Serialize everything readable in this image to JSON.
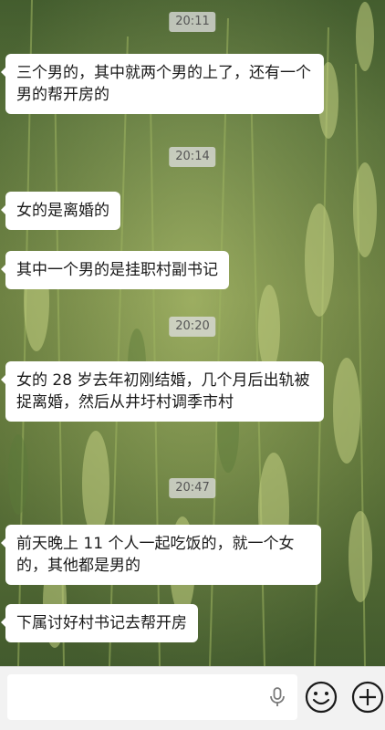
{
  "chat": {
    "messages": [
      {
        "time": "20:11",
        "text": "三个男的，其中就两个男的上了，还有一个男的帮开房的"
      },
      {
        "time": "20:14",
        "text": "女的是离婚的"
      },
      {
        "text": "其中一个男的是挂职村副书记"
      },
      {
        "time": "20:20",
        "text": "女的 28 岁去年初刚结婚，几个月后出轨被捉离婚，然后从井圩村调季市村"
      },
      {
        "time": "20:47",
        "text": "前天晚上 11 个人一起吃饭的，就一个女的，其他都是男的"
      },
      {
        "text": "下属讨好村书记去帮开房"
      }
    ]
  },
  "input_bar": {
    "icons": [
      "mic-icon",
      "emoji-icon",
      "plus-icon"
    ]
  },
  "colors": {
    "bubble_bg": "#ffffff",
    "timestamp_bg": "#dcdcdc",
    "input_bar_bg": "#f2f2f2"
  }
}
